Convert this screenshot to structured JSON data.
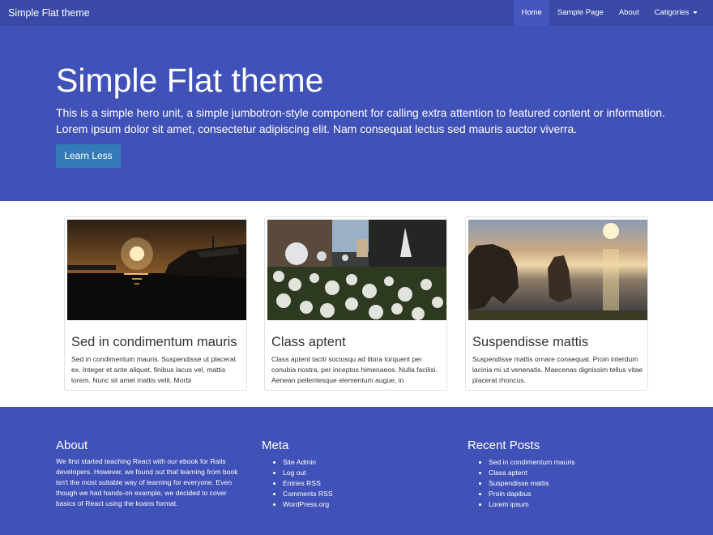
{
  "navbar": {
    "brand": "Simple Flat theme",
    "items": [
      {
        "label": "Home"
      },
      {
        "label": "Sample Page"
      },
      {
        "label": "About"
      },
      {
        "label": "Catigories"
      }
    ]
  },
  "hero": {
    "title": "Simple Flat theme",
    "text": "This is a simple hero unit, a simple jumbotron-style component for calling extra attention to featured content or information. Lorem ipsum dolor sit amet, consectetur adipiscing elit. Nam consequat lectus sed mauris auctor viverra.",
    "button": "Learn Less"
  },
  "cards": [
    {
      "title": "Sed in condimentum mauris",
      "text": "Sed in condimentum mauris. Suspendisse ut placerat ex. Integer et ante aliquet, finibus lacus vel, mattis lorem. Nunc sit amet mattis velit. Morbi"
    },
    {
      "title": "Class aptent",
      "text": "Class aptent taciti sociosqu ad litora torquent per conubia nostra, per inceptos himenaeos. Nulla facilisi. Aenean pellentesque elementum augue, in"
    },
    {
      "title": "Suspendisse mattis",
      "text": "Suspendisse mattis ornare consequat. Proin interdum lacinia mi ut venenatis. Maecenas dignissim tellus vitae placerat rhoncus."
    }
  ],
  "footer": {
    "about": {
      "title": "About",
      "text": "We first started teaching React with our ebook for Rails developers. However, we found out that learning from book isn't the most suitable way of learning for everyone. Even though we had hands-on example, we decided to cover basics of React using the koans format."
    },
    "meta": {
      "title": "Meta",
      "links": [
        "Site Admin",
        "Log out",
        "Entries RSS",
        "Comments RSS",
        "WordPress.org"
      ]
    },
    "recent": {
      "title": "Recent Posts",
      "links": [
        "Sed in condimentum mauris",
        "Class aptent",
        "Suspendisse mattis",
        "Proin dapibus",
        "Lorem ipsum"
      ]
    }
  },
  "colors": {
    "navbar": "#3949a5",
    "hero": "#4051b7",
    "button": "#337ab7",
    "footer": "#4051b7"
  }
}
